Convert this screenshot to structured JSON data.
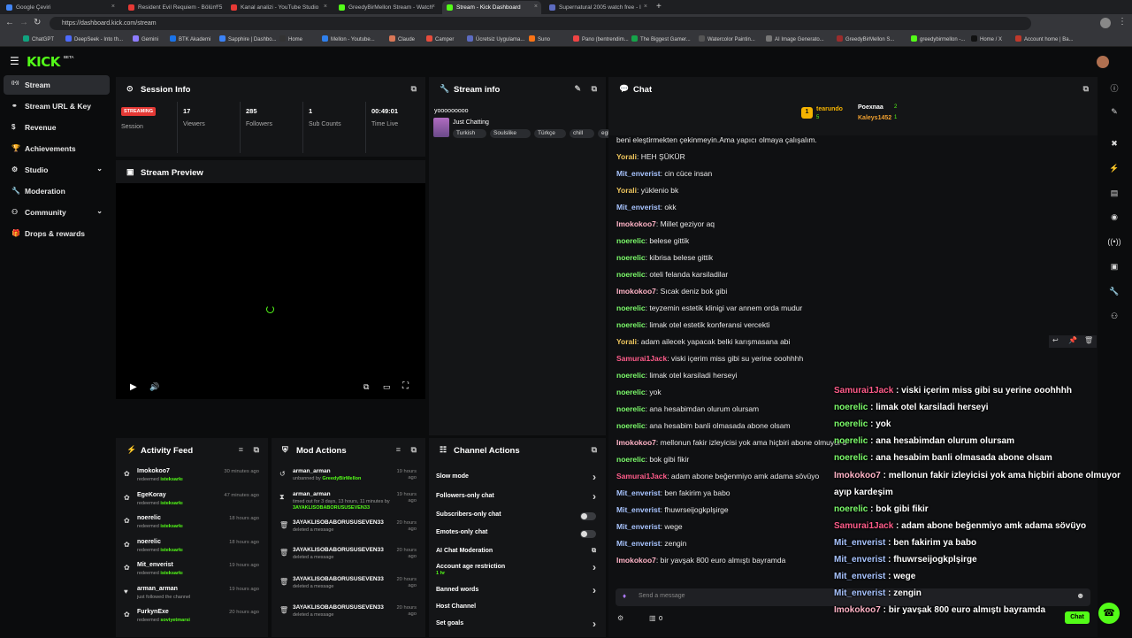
{
  "browser": {
    "tabs": [
      {
        "label": "Google Çeviri",
        "color": "#4285f4",
        "active": false
      },
      {
        "label": "Resident Evil Requiem - Bölüm 5",
        "color": "#e53935",
        "active": false
      },
      {
        "label": "Kanal analizi - YouTube Studio",
        "color": "#e53935",
        "active": false
      },
      {
        "label": "GreedyBirMellon Stream - Watch",
        "color": "#53fc18",
        "active": false
      },
      {
        "label": "Stream - Kick Dashboard",
        "color": "#53fc18",
        "active": true
      },
      {
        "label": "Supernatural 2005 watch free - I",
        "color": "#5c6bc0",
        "active": false
      }
    ],
    "url": "https://dashboard.kick.com/stream",
    "bookmarks": [
      "ChatGPT",
      "DeepSeek - Into th...",
      "Gemini",
      "BTK Akademi",
      "Sapphire | Dashbo...",
      "Home",
      "Mellon - Youtube...",
      "Claude",
      "Camper",
      "Ücretsiz Uygulama...",
      "Suno",
      "Pano (bentrendim...",
      "The Biggest Gamer...",
      "Watercolor Paintin...",
      "AI Image Generato...",
      "GreedyBirMellon S...",
      "greedybirmellon -...",
      "Home / X",
      "Account home | Ba..."
    ]
  },
  "app": {
    "logo": "KICK",
    "logo_badge": "BETA"
  },
  "sidebar": {
    "items": [
      {
        "label": "Stream",
        "icon": "stream-icon"
      },
      {
        "label": "Stream URL & Key",
        "icon": "link-icon"
      },
      {
        "label": "Revenue",
        "icon": "dollar-icon"
      },
      {
        "label": "Achievements",
        "icon": "trophy-icon"
      },
      {
        "label": "Studio",
        "icon": "studio-icon"
      },
      {
        "label": "Moderation",
        "icon": "wrench-icon"
      },
      {
        "label": "Community",
        "icon": "community-icon"
      },
      {
        "label": "Drops & rewards",
        "icon": "gift-icon"
      }
    ]
  },
  "session": {
    "title": "Session Info",
    "status": "STREAMING",
    "status_label": "Session",
    "stats": [
      {
        "value": "17",
        "label": "Viewers"
      },
      {
        "value": "285",
        "label": "Followers"
      },
      {
        "value": "1",
        "label": "Sub Counts"
      },
      {
        "value": "00:49:01",
        "label": "Time Live"
      }
    ]
  },
  "stream_info": {
    "title": "Stream info",
    "stream_title": "yooooooooo",
    "category": "Just Chatting",
    "tags": [
      "Turkish",
      "Soulslike",
      "Türkçe",
      "chill",
      "eglenc"
    ]
  },
  "preview": {
    "title": "Stream Preview"
  },
  "activity": {
    "title": "Activity Feed",
    "items": [
      {
        "name": "Imokokoo7",
        "sub": "redeemed",
        "reward": "isteksarkı",
        "time": "30 minutes ago"
      },
      {
        "name": "EgeKoray",
        "sub": "redeemed",
        "reward": "isteksarkı",
        "time": "47 minutes ago"
      },
      {
        "name": "noerelic",
        "sub": "redeemed",
        "reward": "isteksarkı",
        "time": "18 hours ago"
      },
      {
        "name": "noerelic",
        "sub": "redeemed",
        "reward": "isteksarkı",
        "time": "18 hours ago"
      },
      {
        "name": "Mit_enverist",
        "sub": "redeemed",
        "reward": "isteksarkı",
        "time": "19 hours ago"
      },
      {
        "name": "arman_arman",
        "sub": "just followed the channel",
        "reward": "",
        "time": "19 hours ago"
      },
      {
        "name": "FurkynExe",
        "sub": "redeemed",
        "reward": "soviyetmarsi",
        "time": "20 hours ago"
      }
    ]
  },
  "mod_actions": {
    "title": "Mod Actions",
    "items": [
      {
        "name": "arman_arman",
        "sub": "unbanned by",
        "by": "GreedyBirMellon",
        "time": "19 hours ago"
      },
      {
        "name": "arman_arman",
        "sub": "timed out for 3 days, 13 hours, 11 minutes by",
        "by": "3AYAKLISOBABORUSUSEVEN33",
        "time": "19 hours ago"
      },
      {
        "name": "3AYAKLISOBABORUSUSEVEN33",
        "sub": "deleted a message",
        "by": "",
        "time": "20 hours ago"
      },
      {
        "name": "3AYAKLISOBABORUSUSEVEN33",
        "sub": "deleted a message",
        "by": "",
        "time": "20 hours ago"
      },
      {
        "name": "3AYAKLISOBABORUSUSEVEN33",
        "sub": "deleted a message",
        "by": "",
        "time": "20 hours ago"
      },
      {
        "name": "3AYAKLISOBABORUSUSEVEN33",
        "sub": "deleted a message",
        "by": "",
        "time": "20 hours ago"
      }
    ]
  },
  "channel_actions": {
    "title": "Channel Actions",
    "items": [
      {
        "label": "Slow mode",
        "kind": "arrow"
      },
      {
        "label": "Followers-only chat",
        "kind": "arrow"
      },
      {
        "label": "Subscribers-only chat",
        "kind": "toggle"
      },
      {
        "label": "Emotes-only chat",
        "kind": "toggle"
      },
      {
        "label": "AI Chat Moderation",
        "kind": "ext"
      },
      {
        "label": "Account age restriction",
        "kind": "arrow",
        "sub": "1 hr"
      },
      {
        "label": "Banned words",
        "kind": "arrow"
      },
      {
        "label": "Host Channel",
        "kind": "none"
      },
      {
        "label": "Set goals",
        "kind": "arrow"
      }
    ]
  },
  "chat": {
    "title": "Chat",
    "placeholder": "Send a message",
    "count": "0",
    "send_label": "Chat",
    "top": [
      {
        "name": "tearundo",
        "count": "5"
      },
      {
        "name": "Poexnaa",
        "count": "2"
      },
      {
        "name": "Kaleys1452",
        "count": "1"
      }
    ],
    "top_first": "1",
    "messages": [
      {
        "user": "",
        "color": "#e8e8e8",
        "text": "beni eleştirmekten çekinmeyin.Ama yapıcı olmaya çalışalım."
      },
      {
        "user": "Yorali",
        "color": "#f0c75e",
        "text": "HEH ŞÜKÜR"
      },
      {
        "user": "Mit_enverist",
        "color": "#a8c4ff",
        "text": "cin cüce insan"
      },
      {
        "user": "Yorali",
        "color": "#f0c75e",
        "text": "yüklenio bk"
      },
      {
        "user": "Mit_enverist",
        "color": "#a8c4ff",
        "text": "okk"
      },
      {
        "user": "Imokokoo7",
        "color": "#ffb3c6",
        "text": "Millet geziyor aq"
      },
      {
        "user": "noerelic",
        "color": "#7cfc6b",
        "text": "belese gittik"
      },
      {
        "user": "noerelic",
        "color": "#7cfc6b",
        "text": "kibrisa belese gittik"
      },
      {
        "user": "noerelic",
        "color": "#7cfc6b",
        "text": "oteli felanda karsiladilar"
      },
      {
        "user": "Imokokoo7",
        "color": "#ffb3c6",
        "text": "Sıcak deniz bok gibi"
      },
      {
        "user": "noerelic",
        "color": "#7cfc6b",
        "text": "teyzemin estetik klinigi var annem orda mudur"
      },
      {
        "user": "noerelic",
        "color": "#7cfc6b",
        "text": "limak otel estetik konferansi vercekti"
      },
      {
        "user": "Yorali",
        "color": "#f0c75e",
        "text": "adam ailecek yapacak belki karışmasana abi"
      },
      {
        "user": "Samurai1Jack",
        "color": "#ff5c8a",
        "text": "viski içerim miss gibi su yerine ooohhhh"
      },
      {
        "user": "noerelic",
        "color": "#7cfc6b",
        "text": "limak otel karsiladi herseyi"
      },
      {
        "user": "noerelic",
        "color": "#7cfc6b",
        "text": "yok"
      },
      {
        "user": "noerelic",
        "color": "#7cfc6b",
        "text": "ana hesabimdan olurum olursam"
      },
      {
        "user": "noerelic",
        "color": "#7cfc6b",
        "text": "ana hesabim banli olmasada abone olsam"
      },
      {
        "user": "Imokokoo7",
        "color": "#ffb3c6",
        "text": "mellonun fakir izleyicisi yok ama hiçbiri abone olmuyor ayıp kardeşim"
      },
      {
        "user": "noerelic",
        "color": "#7cfc6b",
        "text": "bok gibi fikir"
      },
      {
        "user": "Samurai1Jack",
        "color": "#ff5c8a",
        "text": "adam abone beğenmiyo amk adama sövüyo"
      },
      {
        "user": "Mit_enverist",
        "color": "#a8c4ff",
        "text": "ben fakirim ya babo"
      },
      {
        "user": "Mit_enverist",
        "color": "#a8c4ff",
        "text": "fhuwrseijogkplşirge"
      },
      {
        "user": "Mit_enverist",
        "color": "#a8c4ff",
        "text": "wege"
      },
      {
        "user": "Mit_enverist",
        "color": "#a8c4ff",
        "text": "zengin"
      },
      {
        "user": "Imokokoo7",
        "color": "#ffb3c6",
        "text": "bir yavşak 800 euro almıştı bayramda"
      }
    ],
    "overlay": [
      {
        "user": "Samurai1Jack",
        "color": "#ff5c8a",
        "text": "viski içerim miss gibi su yerine ooohhhh"
      },
      {
        "user": "noerelic",
        "color": "#7cfc6b",
        "text": "limak otel karsiladi herseyi"
      },
      {
        "user": "noerelic",
        "color": "#7cfc6b",
        "text": "yok"
      },
      {
        "user": "noerelic",
        "color": "#7cfc6b",
        "text": "ana hesabimdan olurum olursam"
      },
      {
        "user": "noerelic",
        "color": "#7cfc6b",
        "text": "ana hesabim banli olmasada abone olsam"
      },
      {
        "user": "Imokokoo7",
        "color": "#ffb3c6",
        "text": "mellonun fakir izleyicisi yok ama hiçbiri abone olmuyor"
      },
      {
        "user": "",
        "color": "#fff",
        "text": "ayıp kardeşim"
      },
      {
        "user": "noerelic",
        "color": "#7cfc6b",
        "text": "bok gibi fikir"
      },
      {
        "user": "Samurai1Jack",
        "color": "#ff5c8a",
        "text": "adam abone beğenmiyo amk adama sövüyo"
      },
      {
        "user": "Mit_enverist",
        "color": "#a8c4ff",
        "text": "ben fakirim ya babo"
      },
      {
        "user": "Mit_enverist",
        "color": "#a8c4ff",
        "text": "fhuwrseijogkplşirge"
      },
      {
        "user": "Mit_enverist",
        "color": "#a8c4ff",
        "text": "wege"
      },
      {
        "user": "Mit_enverist",
        "color": "#a8c4ff",
        "text": "zengin"
      },
      {
        "user": "Imokokoo7",
        "color": "#ffb3c6",
        "text": "bir yavşak 800 euro almıştı bayramda"
      }
    ]
  },
  "colors": {
    "accent": "#53fc18",
    "streaming": "#e53935"
  }
}
